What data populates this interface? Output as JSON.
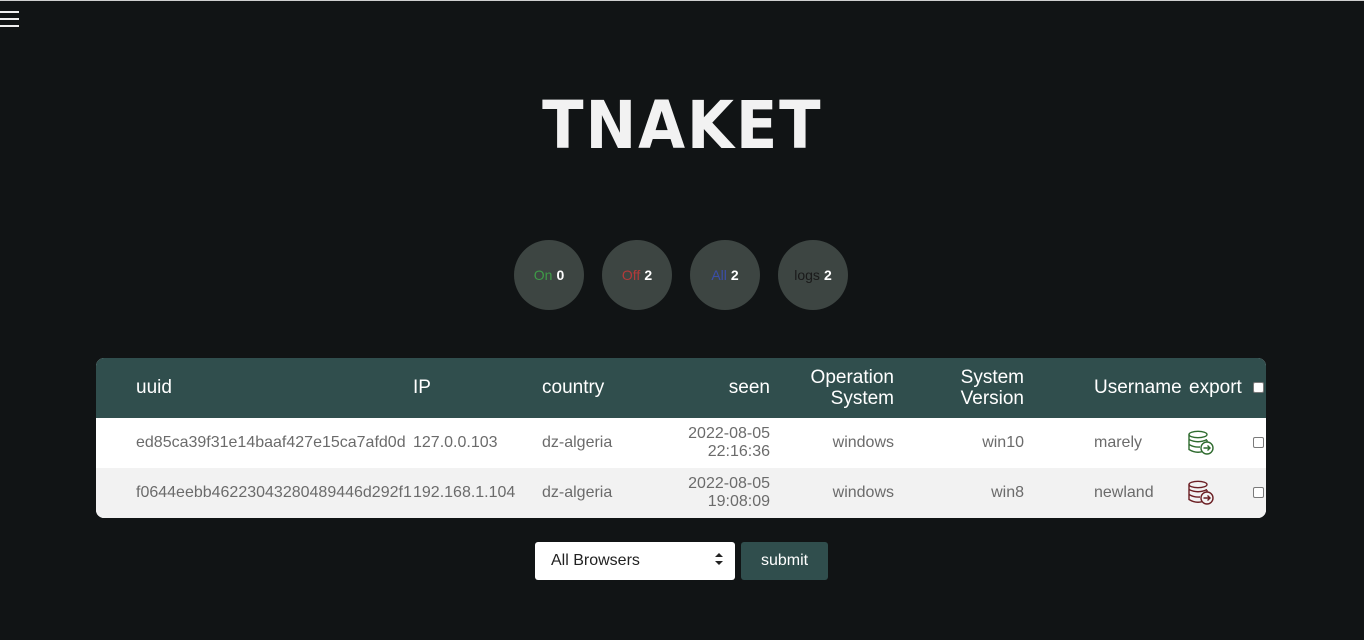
{
  "header": {
    "menu_icon": "hamburger-menu-icon"
  },
  "logo": {
    "text": "TNAKET"
  },
  "stats": [
    {
      "label": "On",
      "count": "0",
      "color": "#3e9a47"
    },
    {
      "label": "Off",
      "count": "2",
      "color": "#b33a3a"
    },
    {
      "label": "All",
      "count": "2",
      "color": "#3b4ea8"
    },
    {
      "label": "logs",
      "count": "2",
      "color": "#1a1a1a"
    }
  ],
  "table": {
    "headers": {
      "uuid": "uuid",
      "ip": "IP",
      "country": "country",
      "seen": "seen",
      "os_line1": "Operation",
      "os_line2": "System",
      "sysver_line1": "System",
      "sysver_line2": "Version",
      "username": "Username",
      "export": "export"
    },
    "rows": [
      {
        "uuid": "ed85ca39f31e14baaf427e15ca7afd0d",
        "ip": "127.0.0.103",
        "country": "dz-algeria",
        "seen_date": "2022-08-05",
        "seen_time": "22:16:36",
        "os": "windows",
        "version": "win10",
        "username": "marely",
        "export_icon": "database-export-icon",
        "export_color": "#2f6b2f"
      },
      {
        "uuid": "f0644eebb46223043280489446d292f1",
        "ip": "192.168.1.104",
        "country": "dz-algeria",
        "seen_date": "2022-08-05",
        "seen_time": "19:08:09",
        "os": "windows",
        "version": "win8",
        "username": "newland",
        "export_icon": "database-export-icon",
        "export_color": "#6b1f24"
      }
    ]
  },
  "controls": {
    "browser_select": "All Browsers",
    "submit_label": "submit"
  }
}
